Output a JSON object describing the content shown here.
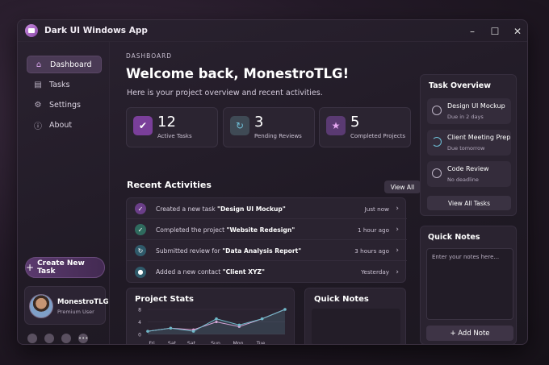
{
  "window": {
    "title": "Dark UI Windows App",
    "controls": [
      "–",
      "☐",
      "✕"
    ]
  },
  "sidebar": {
    "items": [
      {
        "label": "Dashboard",
        "icon": "home-icon",
        "active": true
      },
      {
        "label": "Tasks",
        "icon": "tasks-icon"
      },
      {
        "label": "Settings",
        "icon": "gear-icon"
      },
      {
        "label": "About",
        "icon": "info-icon"
      }
    ],
    "new_task_label": "Create New Task",
    "user": {
      "name": "MonestroTLG",
      "role": "Premium User"
    }
  },
  "main": {
    "section_label": "DASHBOARD",
    "welcome": "Welcome back, MonestroTLG!",
    "subtitle": "Here is your project overview and recent activities.",
    "stats": [
      {
        "value": "12",
        "label": "Active Tasks",
        "icon": "check-icon",
        "color": "#7a3f9a"
      },
      {
        "value": "3",
        "label": "Pending Reviews",
        "icon": "refresh-icon",
        "color": "#3f4a55"
      },
      {
        "value": "5",
        "label": "Completed Projects",
        "icon": "star-icon",
        "color": "#5a3a72"
      }
    ],
    "recent_title": "Recent Activities",
    "view_all": "View All",
    "activities": [
      {
        "prefix": "Created a new task ",
        "target": "\"Design UI Mockup\"",
        "time": "Just now",
        "icon": "check-icon",
        "color": "#6a3e88"
      },
      {
        "prefix": "Completed the project ",
        "target": "\"Website Redesign\"",
        "time": "1 hour ago",
        "icon": "check-icon",
        "color": "#2f6a5e"
      },
      {
        "prefix": "Submitted review for ",
        "target": "\"Data Analysis Report\"",
        "time": "3 hours ago",
        "icon": "refresh-icon",
        "color": "#2f5a6a"
      },
      {
        "prefix": "Added a new contact ",
        "target": "\"Client XYZ\"",
        "time": "Yesterday",
        "icon": "user-icon",
        "color": "#2f5a6a"
      }
    ],
    "project_stats_title": "Project Stats",
    "quick_notes_mid_title": "Quick Notes"
  },
  "chart_data": {
    "type": "line",
    "categories": [
      "Fri",
      "Sat",
      "Sat",
      "Sun",
      "Mon",
      "Tue"
    ],
    "ylim": [
      0,
      8
    ],
    "yticks": [
      "8",
      "4",
      "0"
    ],
    "series": [
      {
        "values": [
          1,
          2,
          1.5,
          4,
          2.5,
          5,
          8
        ],
        "color": "#e9a0d8"
      },
      {
        "values": [
          1,
          2,
          1,
          5,
          3,
          5,
          8
        ],
        "color": "#6fb8c8"
      }
    ]
  },
  "task_overview": {
    "title": "Task Overview",
    "tasks": [
      {
        "name": "Design UI Mockup",
        "due": "Due in 2 days"
      },
      {
        "name": "Client Meeting Prep",
        "due": "Due tomorrow"
      },
      {
        "name": "Code Review",
        "due": "No deadline"
      }
    ],
    "view_all_label": "View All Tasks"
  },
  "quick_notes": {
    "title": "Quick Notes",
    "placeholder": "Enter your notes here...",
    "add_label": "+ Add Note"
  }
}
